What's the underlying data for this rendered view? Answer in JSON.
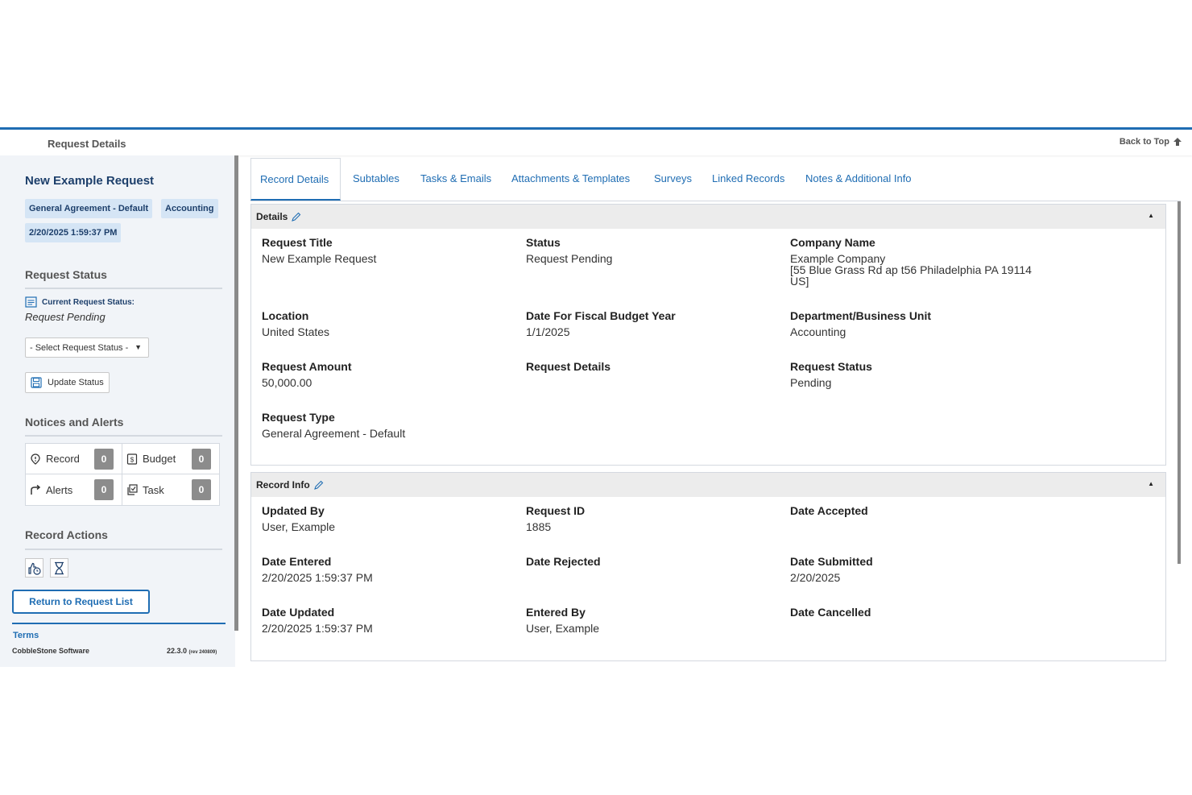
{
  "page": {
    "title": "Request Details",
    "back_to_top": "Back to Top"
  },
  "sidebar": {
    "record_title": "New Example Request",
    "tags": [
      "General Agreement - Default",
      "Accounting",
      "2/20/2025 1:59:37 PM"
    ],
    "request_status_heading": "Request Status",
    "current_status_label": "Current Request Status:",
    "current_status_value": "Request Pending",
    "status_select_value": "- Select Request Status -",
    "update_status_label": "Update Status",
    "notices_heading": "Notices and Alerts",
    "notices": [
      {
        "label": "Record",
        "count": "0",
        "icon": "pin-icon"
      },
      {
        "label": "Budget",
        "count": "0",
        "icon": "budget-icon"
      },
      {
        "label": "Alerts",
        "count": "0",
        "icon": "alert-route-icon"
      },
      {
        "label": "Task",
        "count": "0",
        "icon": "task-icon"
      }
    ],
    "record_actions_heading": "Record Actions",
    "return_button": "Return to Request List",
    "terms": "Terms",
    "company": "CobbleStone Software",
    "version": "22.3.0",
    "version_rev": "(rev 240809)"
  },
  "tabs": [
    "Record Details",
    "Subtables",
    "Tasks & Emails",
    "Attachments & Templates",
    "Surveys",
    "Linked Records",
    "Notes & Additional Info"
  ],
  "details": {
    "heading": "Details",
    "fields": [
      {
        "label": "Request Title",
        "value": "New Example Request"
      },
      {
        "label": "Status",
        "value": "Request Pending"
      },
      {
        "label": "Company Name",
        "value": "Example Company\n[55 Blue Grass Rd ap t56 Philadelphia PA 19114\nUS]"
      },
      {
        "label": "Location",
        "value": "United States"
      },
      {
        "label": "Date For Fiscal Budget Year",
        "value": "1/1/2025"
      },
      {
        "label": "Department/Business Unit",
        "value": "Accounting"
      },
      {
        "label": "Request Amount",
        "value": "50,000.00"
      },
      {
        "label": "Request Details",
        "value": ""
      },
      {
        "label": "Request Status",
        "value": "Pending"
      },
      {
        "label": "Request Type",
        "value": "General Agreement - Default"
      }
    ]
  },
  "record_info": {
    "heading": "Record Info",
    "fields": [
      {
        "label": "Updated By",
        "value": "User, Example"
      },
      {
        "label": "Request ID",
        "value": "1885"
      },
      {
        "label": "Date Accepted",
        "value": ""
      },
      {
        "label": "Date Entered",
        "value": "2/20/2025 1:59:37 PM"
      },
      {
        "label": "Date Rejected",
        "value": ""
      },
      {
        "label": "Date Submitted",
        "value": "2/20/2025"
      },
      {
        "label": "Date Updated",
        "value": "2/20/2025 1:59:37 PM"
      },
      {
        "label": "Entered By",
        "value": "User, Example"
      },
      {
        "label": "Date Cancelled",
        "value": ""
      }
    ]
  },
  "colors": {
    "accent": "#1f6db3",
    "tag_bg": "#d5e5f5",
    "count_bg": "#8c8c8c"
  }
}
